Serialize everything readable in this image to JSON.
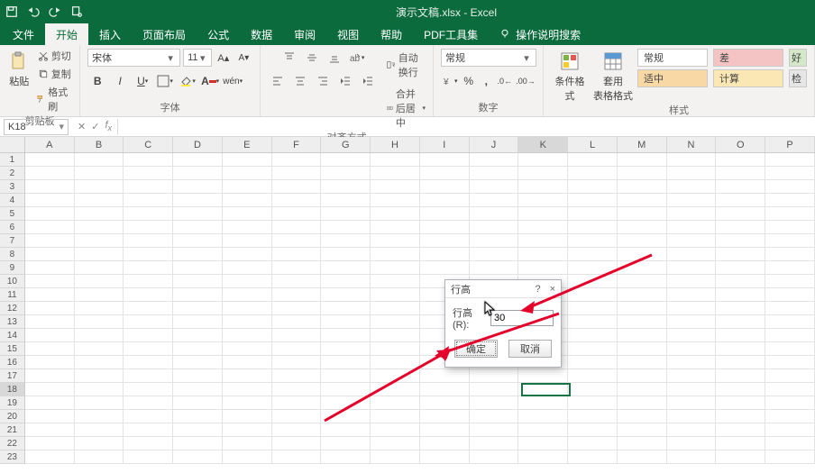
{
  "title": "演示文稿.xlsx - Excel",
  "tabs": {
    "file": "文件",
    "home": "开始",
    "insert": "插入",
    "layout": "页面布局",
    "formulas": "公式",
    "data": "数据",
    "review": "审阅",
    "view": "视图",
    "help": "帮助",
    "pdftools": "PDF工具集",
    "tellme": "操作说明搜索"
  },
  "ribbon": {
    "clipboard": {
      "paste": "粘贴",
      "cut": "剪切",
      "copy": "复制",
      "format_painter": "格式刷",
      "label": "剪贴板"
    },
    "font": {
      "name": "宋体",
      "size": "11",
      "label": "字体"
    },
    "alignment": {
      "wrap": "自动换行",
      "merge": "合并后居中",
      "label": "对齐方式"
    },
    "number": {
      "format": "常规",
      "label": "数字"
    },
    "styles": {
      "cond_fmt": "条件格式",
      "table_fmt": "套用\n表格格式",
      "normal": "常规",
      "bad": "差",
      "good": "好",
      "neutral": "适中",
      "calc": "计算",
      "check": "检",
      "label": "样式"
    }
  },
  "formula_bar": {
    "cell_ref": "K18"
  },
  "columns": [
    "A",
    "B",
    "C",
    "D",
    "E",
    "F",
    "G",
    "H",
    "I",
    "J",
    "K",
    "L",
    "M",
    "N",
    "O",
    "P"
  ],
  "rows_count": 23,
  "active": {
    "col_idx": 10,
    "row": 18
  },
  "dialog": {
    "title": "行高",
    "help": "?",
    "close": "×",
    "label": "行高(R):",
    "value": "30",
    "ok": "确定",
    "cancel": "取消"
  }
}
